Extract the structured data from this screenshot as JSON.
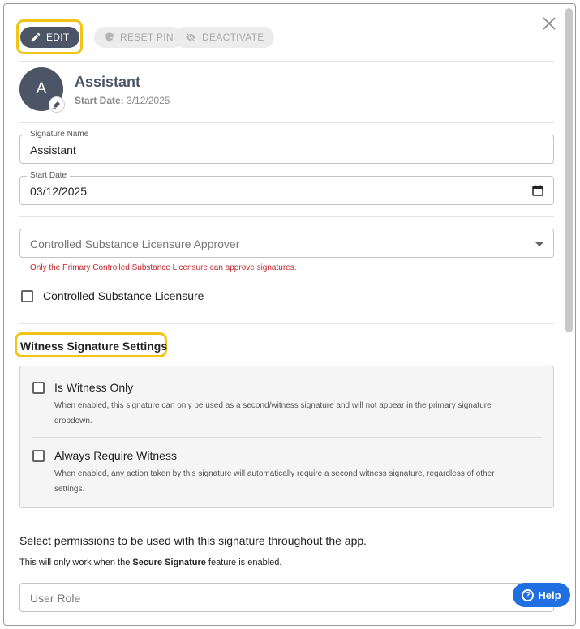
{
  "toolbar": {
    "edit_label": "EDIT",
    "reset_pin_label": "RESET PIN",
    "deactivate_label": "DEACTIVATE"
  },
  "profile": {
    "avatar_initial": "A",
    "name": "Assistant",
    "start_date_label": "Start Date:",
    "start_date_value": "3/12/2025"
  },
  "fields": {
    "signature_name_label": "Signature Name",
    "signature_name_value": "Assistant",
    "start_date_label": "Start Date",
    "start_date_value": "03/12/2025"
  },
  "licensure": {
    "approver_placeholder": "Controlled Substance Licensure Approver",
    "approver_error": "Only the Primary Controlled Substance Licensure can approve signatures.",
    "checkbox_label": "Controlled Substance Licensure",
    "checked": false
  },
  "witness": {
    "section_title": "Witness Signature Settings",
    "items": [
      {
        "label": "Is Witness Only",
        "checked": false,
        "description": "When enabled, this signature can only be used as a second/witness signature and will not appear in the primary signature dropdown."
      },
      {
        "label": "Always Require Witness",
        "checked": false,
        "description": "When enabled, any action taken by this signature will automatically require a second witness signature, regardless of other settings."
      }
    ]
  },
  "permissions": {
    "title": "Select permissions to be used with this signature throughout the app.",
    "note_before": "This will only work when the ",
    "note_bold": "Secure Signature",
    "note_after": " feature is enabled.",
    "user_role_placeholder": "User Role"
  },
  "help": {
    "label": "Help"
  },
  "colors": {
    "accent_dark": "#4c5566",
    "highlight": "#f2c417",
    "error": "#c0282d",
    "help_blue": "#1f6fe0"
  }
}
